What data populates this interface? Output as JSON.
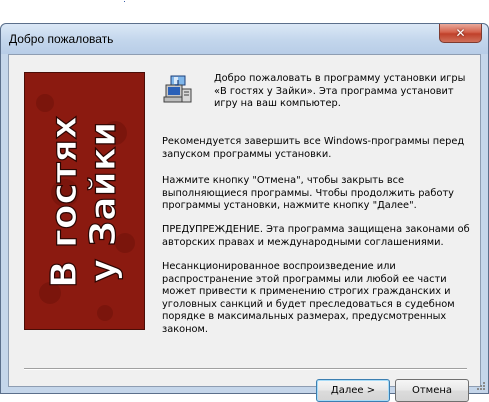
{
  "window": {
    "title": "Добро пожаловать",
    "close_glyph": "✕"
  },
  "banner": {
    "line1": "В гостях",
    "line2": "у Зайки",
    "background_color": "#8b1a10",
    "text_color": "#ffffff"
  },
  "icon": "setup-computer-icon",
  "content": {
    "intro": "Добро пожаловать в программу установки игры «В гостях у Зайки». Эта программа установит игру на ваш компьютер.",
    "recommend": "Рекомендуется завершить все Windows-программы перед запуском программы установки.",
    "instructions": "Нажмите кнопку \"Отмена\", чтобы закрыть все выполняющиеся программы. Чтобы продолжить работу программы установки, нажмите кнопку \"Далее\".",
    "warning": "ПРЕДУПРЕЖДЕНИЕ. Эта программа защищена законами об авторских правах и международными соглашениями.",
    "legal": "Несанкционированное воспроизведение или распространение этой программы или любой ее части может привести к применению строгих гражданских и уголовных санкций и будет преследоваться в судебном порядке в максимальных размерах, предусмотренных законом."
  },
  "buttons": {
    "next": "Далее >",
    "cancel": "Отмена"
  }
}
